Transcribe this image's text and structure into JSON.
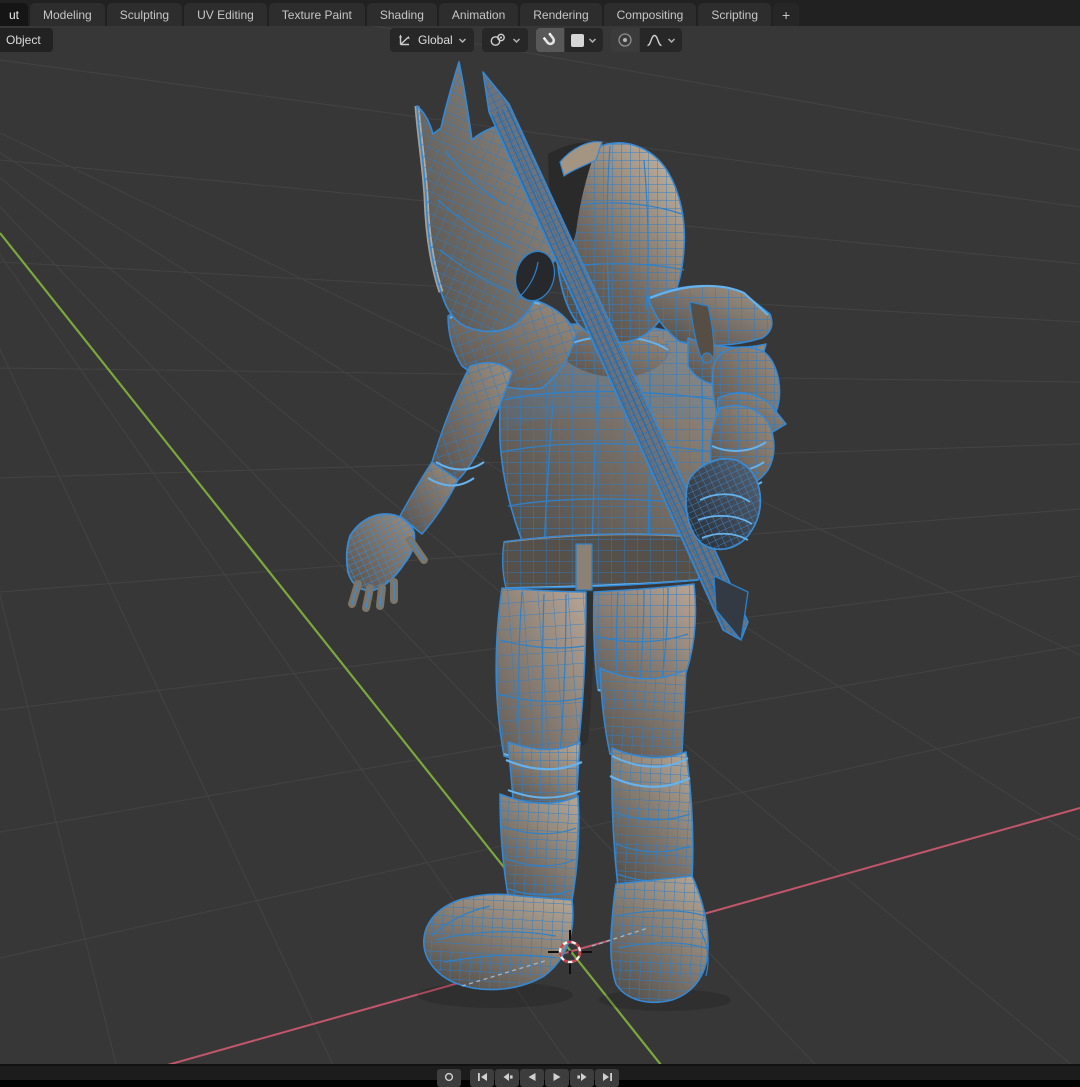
{
  "workspace_tabs": {
    "items": [
      {
        "label": "ut",
        "active": true
      },
      {
        "label": "Modeling"
      },
      {
        "label": "Sculpting"
      },
      {
        "label": "UV Editing"
      },
      {
        "label": "Texture Paint"
      },
      {
        "label": "Shading"
      },
      {
        "label": "Animation"
      },
      {
        "label": "Rendering"
      },
      {
        "label": "Compositing"
      },
      {
        "label": "Scripting"
      },
      {
        "label": "+"
      }
    ]
  },
  "header": {
    "mode_label": "Object",
    "transform_orientation": {
      "label": "Global",
      "icon": "orientation-axes-icon"
    },
    "pivot_point": {
      "icon": "pivot-point-icon"
    },
    "snapping": {
      "enabled": true,
      "icon": "magnet-icon",
      "target_icon": "snap-target-square-icon"
    },
    "proportional_editing": {
      "icon": "proportional-radius-icon",
      "falloff_icon": "falloff-curve-icon"
    }
  },
  "viewport": {
    "background_color": "#373737",
    "grid_line_color": "#434343",
    "axis_x_color": "#c2566a",
    "axis_y_color": "#7ba73d",
    "wireframe_color": "#2d7ec8",
    "wireframe_highlight": "#66b2ec",
    "content": "knight character model with axe shown in wireframe edit overlay, viewed from behind; 3D cursor at world origin between the boots"
  },
  "playback": {
    "buttons": [
      {
        "name": "auto-keying"
      },
      {
        "name": "jump-to-start"
      },
      {
        "name": "previous-keyframe"
      },
      {
        "name": "play-reverse"
      },
      {
        "name": "play"
      },
      {
        "name": "next-keyframe"
      },
      {
        "name": "jump-to-end"
      }
    ]
  }
}
